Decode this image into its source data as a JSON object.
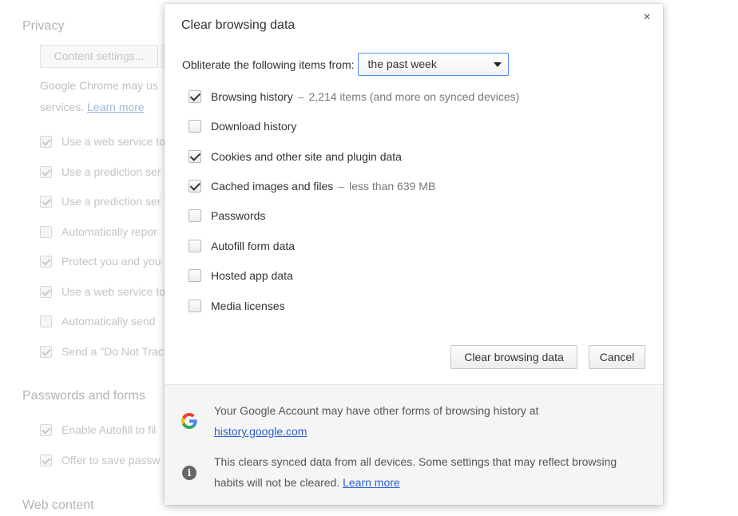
{
  "background": {
    "privacy_heading": "Privacy",
    "content_settings_button": "Content settings...",
    "description_line1": "Google Chrome may us",
    "description_line2_prefix": "services. ",
    "description_link": "Learn more",
    "privacy_items": [
      {
        "label": "Use a web service to",
        "checked": true
      },
      {
        "label": "Use a prediction ser",
        "checked": true
      },
      {
        "label": "Use a prediction ser",
        "checked": true
      },
      {
        "label": "Automatically repor",
        "checked": false
      },
      {
        "label": "Protect you and you",
        "checked": true
      },
      {
        "label": "Use a web service to",
        "checked": true
      },
      {
        "label": "Automatically send",
        "checked": false
      },
      {
        "label": "Send a \"Do Not Trac",
        "checked": true
      }
    ],
    "passwords_heading": "Passwords and forms",
    "password_items": [
      {
        "label": "Enable Autofill to fil",
        "checked": true
      },
      {
        "label": "Offer to save passw",
        "checked": true
      }
    ],
    "web_content_heading": "Web content"
  },
  "dialog": {
    "title": "Clear browsing data",
    "close_symbol": "×",
    "period_label": "Obliterate the following items from:",
    "period_value": "the past week",
    "options": [
      {
        "label": "Browsing history",
        "detail": "2,214 items (and more on synced devices)",
        "checked": true
      },
      {
        "label": "Download history",
        "detail": "",
        "checked": false
      },
      {
        "label": "Cookies and other site and plugin data",
        "detail": "",
        "checked": true
      },
      {
        "label": "Cached images and files",
        "detail": "less than 639 MB",
        "checked": true
      },
      {
        "label": "Passwords",
        "detail": "",
        "checked": false
      },
      {
        "label": "Autofill form data",
        "detail": "",
        "checked": false
      },
      {
        "label": "Hosted app data",
        "detail": "",
        "checked": false
      },
      {
        "label": "Media licenses",
        "detail": "",
        "checked": false
      }
    ],
    "separator": "–",
    "clear_button": "Clear browsing data",
    "cancel_button": "Cancel",
    "footer": {
      "google_note_text": "Your Google Account may have other forms of browsing history at",
      "google_note_link": "history.google.com",
      "info_note_text": "This clears synced data from all devices. Some settings that may reflect browsing habits will not be cleared.",
      "info_note_link": "Learn more",
      "info_icon_glyph": "i"
    },
    "icons": {
      "google": "google-g-icon",
      "info": "info-icon"
    }
  }
}
